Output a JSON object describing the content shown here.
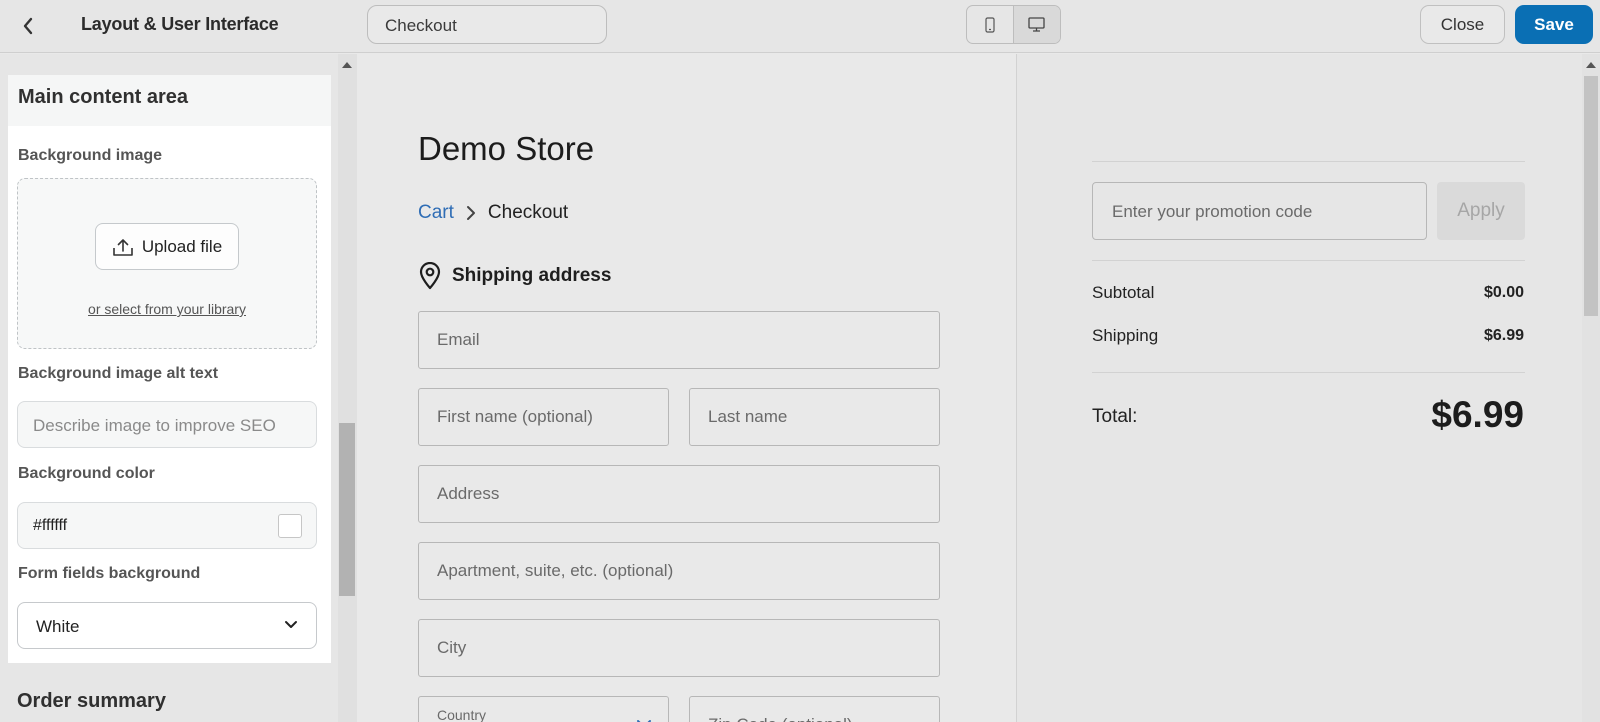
{
  "topbar": {
    "title": "Layout & User Interface",
    "page_selector": "Checkout",
    "close_label": "Close",
    "save_label": "Save",
    "save_color": "#0a6fb4"
  },
  "left_panel": {
    "section_title": "Main content area",
    "background_image": {
      "label": "Background image",
      "upload_label": "Upload file",
      "library_link": "or select from your library"
    },
    "alt_text": {
      "label": "Background image alt text",
      "placeholder": "Describe image to improve SEO"
    },
    "background_color": {
      "label": "Background color",
      "value": "#ffffff"
    },
    "form_fields_background": {
      "label": "Form fields background",
      "value": "White"
    },
    "next_section_title": "Order summary"
  },
  "preview": {
    "store_name": "Demo Store",
    "breadcrumb": {
      "cart": "Cart",
      "current": "Checkout"
    },
    "shipping_heading": "Shipping address",
    "fields": {
      "email": "Email",
      "first_name": "First name (optional)",
      "last_name": "Last name",
      "address": "Address",
      "apartment": "Apartment, suite, etc. (optional)",
      "city": "City",
      "country": "Country",
      "zip": "Zip Code (optional)"
    },
    "summary": {
      "promo_placeholder": "Enter your promotion code",
      "apply_label": "Apply",
      "subtotal_label": "Subtotal",
      "subtotal_value": "$0.00",
      "shipping_label": "Shipping",
      "shipping_value": "$6.99",
      "total_label": "Total:",
      "total_value": "$6.99"
    }
  }
}
